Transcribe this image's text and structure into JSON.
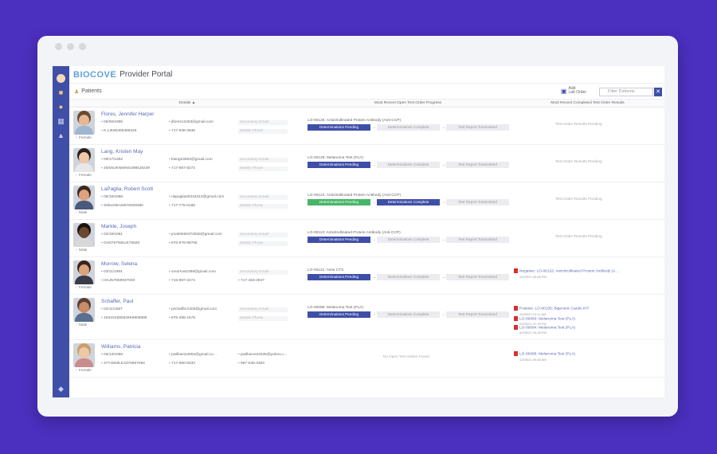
{
  "app": {
    "logo": "BIOCOVE",
    "title": "Provider Portal",
    "breadcrumb": "Patients",
    "add_order": "Add\nLab Order",
    "filter_placeholder": "Filter Patients"
  },
  "columns": {
    "details": "Details ▲",
    "progress": "Most Recent Open Test Order Progress",
    "results": "Most Recent Completed Test Order Results"
  },
  "labels": {
    "secondary_email": "Secondary Email",
    "mobile_phone": "Mobile Phone",
    "pending": "Determinations Pending",
    "complete": "Determinations Complete",
    "transmitted": "Test Report Transmitted",
    "no_open": "No Open Test Orders Found",
    "results_pending": "Test Order Results Pending"
  },
  "colors": {
    "accent": "#3f4fa8",
    "green": "#47b568",
    "background": "#4b2fbf"
  },
  "patients": [
    {
      "name": "Flores, Jennifer Harper",
      "dob": "05/06/1996",
      "id": "K-LIK90495489345",
      "email": "jflores12453@gmail.com",
      "phone": "717-838-3838",
      "gender": "Female",
      "test": "LO-00126: Anticitrullinated Protein Antibody (Anti-CCP)",
      "result": ""
    },
    {
      "name": "Lang, Kristen May",
      "dob": "09/17/1992",
      "id": "JMSNJKN89NS3985J8239",
      "email": "klang23893@gmail.com",
      "phone": "717-987-8273",
      "gender": "Female",
      "test": "LO-00129: Melanoma Test (PLA)",
      "result": ""
    },
    {
      "name": "LaPaglia, Robert Scott",
      "dob": "08/18/1988",
      "id": "S89LD9HJ8978309380",
      "email": "rlapaglia25232310@gmail.com",
      "phone": "717-775-0188",
      "gender": "Male",
      "test": "LO-00124: Anticitrullinated Protein Antibody (Anti-CCP)",
      "result": ""
    },
    {
      "name": "Markle, Joseph",
      "dob": "02/19/1981",
      "id": "GH6767NBLIK76500",
      "email": "jmarkle55372828@gmail.com",
      "phone": "876-876-98765",
      "gender": "Male",
      "test": "LO-00113: Anticitrullinated Protein Antibody (Anti-CCP)",
      "result": ""
    },
    {
      "name": "Morrow, Selena",
      "dob": "03/11/1984",
      "id": "HKJN7859937000",
      "email": "smorrow2398@gmail.com",
      "phone": "715-987-2474",
      "phone2": "717-463-3837",
      "gender": "Female",
      "test": "LO-00121: Assa CTS",
      "result": "Negative: LO-00122: Anticitrullinated Protein Antibody (A...",
      "result_date": "02/03/21 09:38 PM"
    },
    {
      "name": "Schaffer, Paul",
      "dob": "02/11/1987",
      "id": "JD3424585849K8909898",
      "email": "pschaffer2405@gmail.com",
      "phone": "876-398-1678",
      "gender": "Male",
      "test": "LO-00098: Melanoma Test (PLA)",
      "result": "Positive: LO-00105: Bigenetic Cardio KIT",
      "result_date": "02/05/21 10:11 AM",
      "result2": "LO-00083: Melanoma Test (PLA)",
      "result2_date": "02/05/21 07:18 PM",
      "result3": "LO-00084: Melanoma Test (PLA)",
      "result3_date": "02/05/21 09:38 PM"
    },
    {
      "name": "Williams, Patricia",
      "dob": "06/13/1988",
      "id": "37Y4848LK4375897050",
      "email": "pwilliams4852@gmail.co...",
      "email2": "pwilliams24535@yahoo.c...",
      "phone": "717-890-9333",
      "phone2": "987-635-3393",
      "gender": "Female",
      "test": "",
      "result": "LO-00085: Melanoma Test (PLA)",
      "result_date": "02/05/21 09:38 AM"
    }
  ]
}
